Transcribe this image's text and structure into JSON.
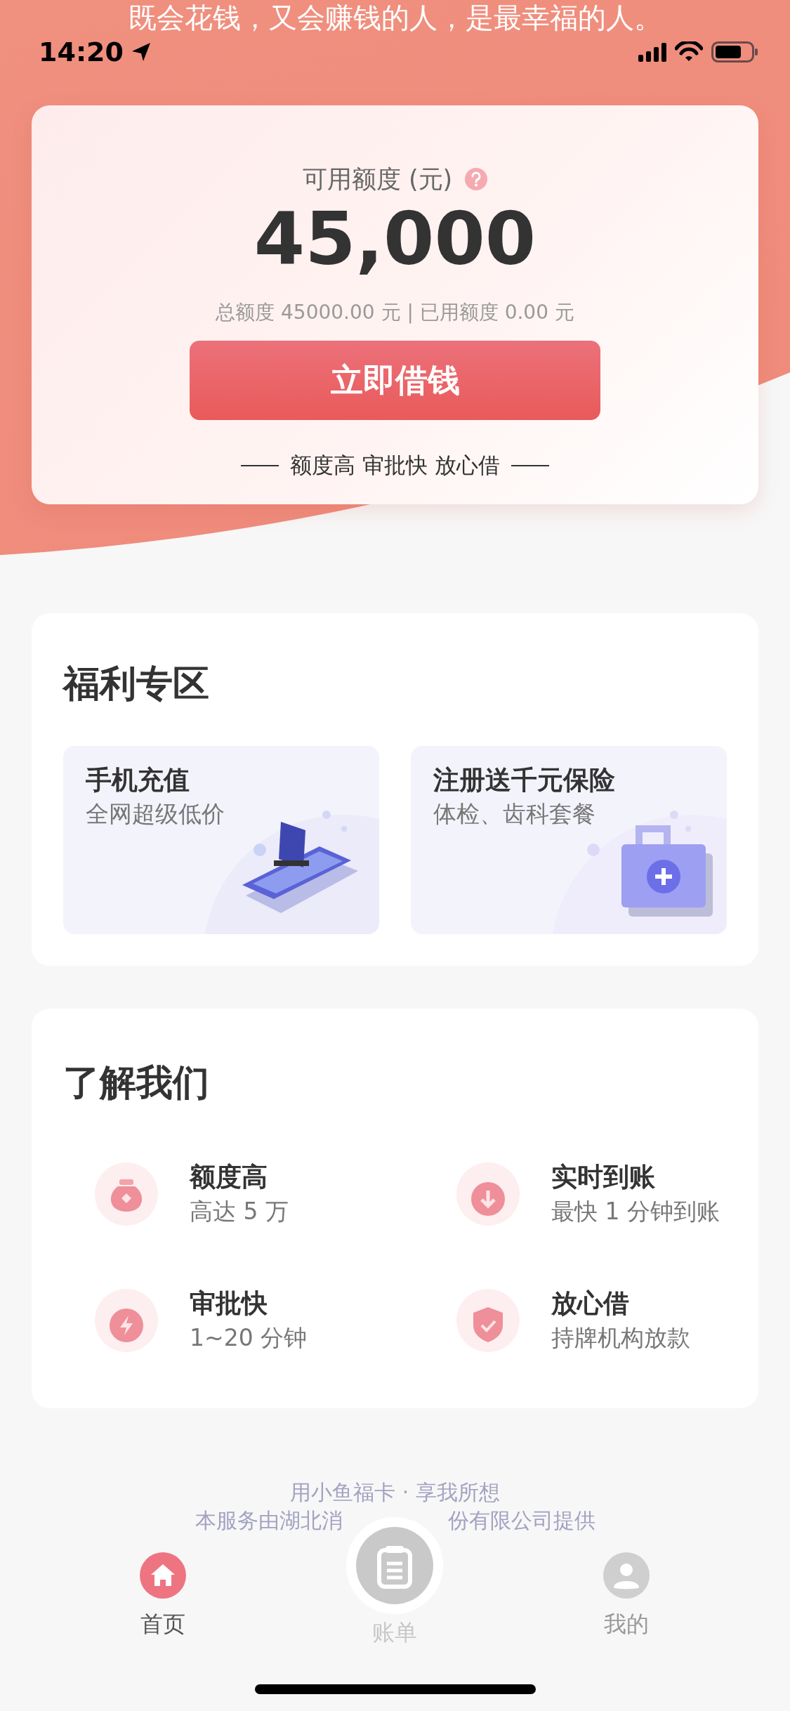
{
  "slogan": "既会花钱，又会赚钱的人，是最幸福的人。",
  "status_bar": {
    "time": "14:20"
  },
  "credit_card": {
    "label": "可用额度 (元)",
    "amount": "45,000",
    "detail": "总额度 45000.00 元 | 已用额度 0.00 元",
    "button": "立即借钱",
    "tagline": "额度高 审批快 放心借"
  },
  "welfare": {
    "title": "福利专区",
    "tiles": [
      {
        "title": "手机充值",
        "subtitle": "全网超级低价"
      },
      {
        "title": "注册送千元保险",
        "subtitle": "体检、齿科套餐"
      }
    ]
  },
  "about": {
    "title": "了解我们",
    "items": [
      {
        "title": "额度高",
        "subtitle": "高达 5 万"
      },
      {
        "title": "实时到账",
        "subtitle": "最快 1 分钟到账"
      },
      {
        "title": "审批快",
        "subtitle": "1~20 分钟"
      },
      {
        "title": "放心借",
        "subtitle": "持牌机构放款"
      }
    ]
  },
  "footer": {
    "motto": "用小鱼福卡 · 享我所想",
    "notice_left": "本服务由湖北消",
    "notice_right": "份有限公司提供"
  },
  "tabs": [
    {
      "label": "首页",
      "kind": "icon",
      "selected": true
    },
    {
      "label": "账单",
      "kind": "raised",
      "selected": false
    },
    {
      "label": "我的",
      "kind": "icon",
      "selected": false
    }
  ]
}
